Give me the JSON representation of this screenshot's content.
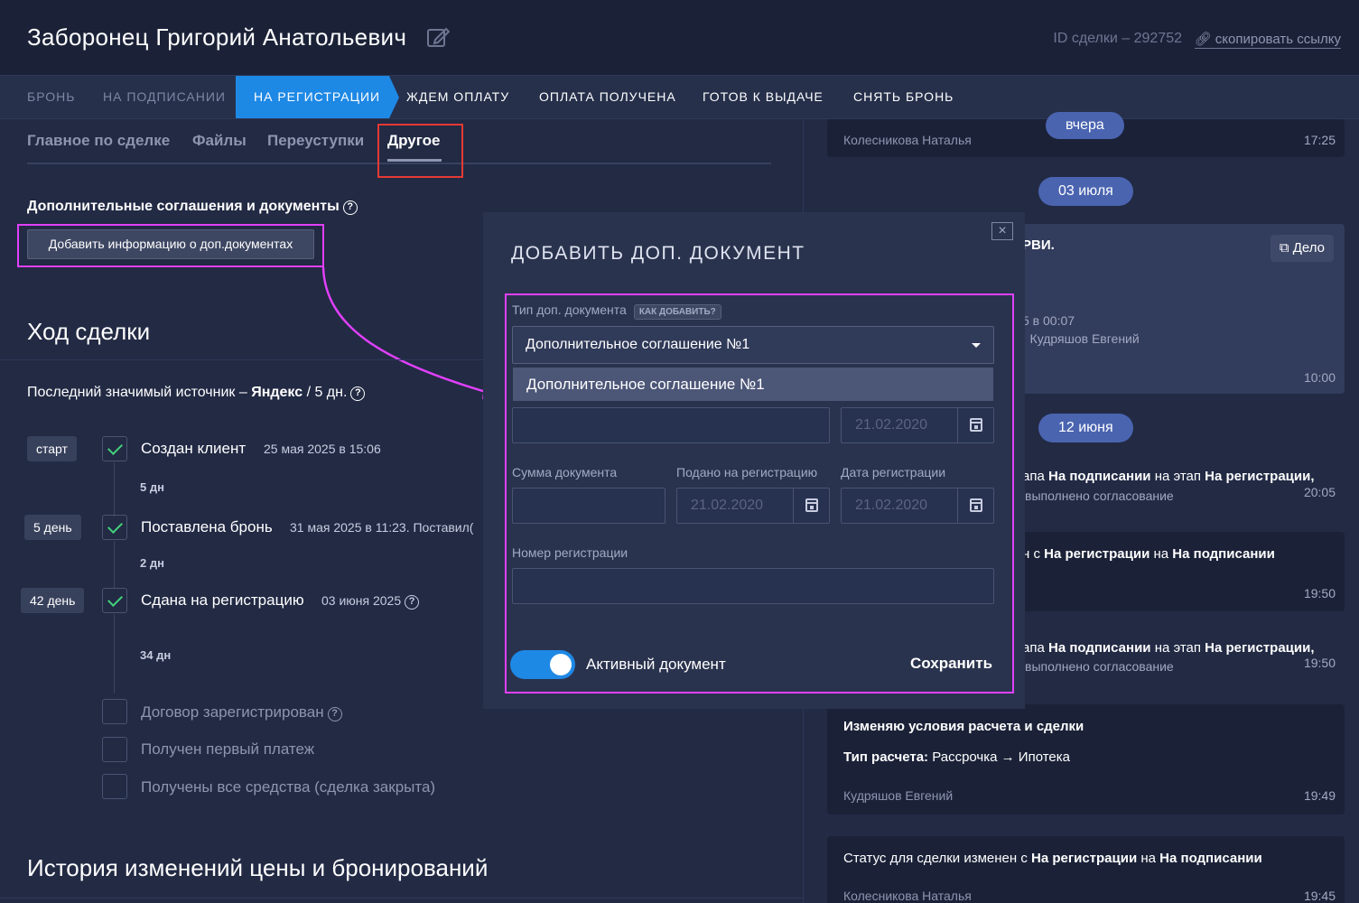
{
  "header": {
    "client_name": "Заборонец Григорий Анатольевич",
    "deal_id": "ID сделки – 292752",
    "copy_link": "скопировать ссылку"
  },
  "stages": [
    {
      "label": "Бронь",
      "state": "past"
    },
    {
      "label": "На подписании",
      "state": "past"
    },
    {
      "label": "На регистрации",
      "state": "active"
    },
    {
      "label": "Ждем оплату",
      "state": "future"
    },
    {
      "label": "Оплата получена",
      "state": "future"
    },
    {
      "label": "Готов к выдаче",
      "state": "future"
    },
    {
      "label": "Снять бронь",
      "state": "future"
    }
  ],
  "subtabs": [
    "Главное по сделке",
    "Файлы",
    "Переуступки",
    "Другое"
  ],
  "subtab_active": "Другое",
  "docs": {
    "title": "Дополнительные соглашения и документы",
    "add_button": "Добавить информацию о доп.документах"
  },
  "deal_progress": {
    "title": "Ход сделки",
    "source_prefix": "Последний значимый источник –",
    "source_name": "Яндекс",
    "source_suffix": "/ 5 дн.",
    "steps": [
      {
        "badge": "старт",
        "title": "Создан клиент",
        "date": "25 мая 2025 в 15:06",
        "gap_after": "5 дн"
      },
      {
        "badge": "5 день",
        "title": "Поставлена бронь",
        "date": "31 мая 2025 в 11:23. Поставил(",
        "gap_after": "2 дн"
      },
      {
        "badge": "42 день",
        "title": "Сдана на регистрацию",
        "date": "03 июня 2025",
        "gap_after": "34 дн"
      }
    ],
    "pending": [
      "Договор зарегистрирован",
      "Получен первый платеж",
      "Получены все средства (сделка закрыта)"
    ]
  },
  "history_title": "История изменений цены и бронирований",
  "feed": {
    "card0": {
      "author": "Колесникова Наталья",
      "time": "17:25"
    },
    "pill_yesterday": "вчера",
    "pill_july": "03 июля",
    "card1": {
      "text_frag": "РВИ.",
      "badge": "Дело",
      "sub1": "5 в 00:07",
      "sub2": "· Кудряшов Евгений",
      "time": "10:00"
    },
    "pill_june": "12 июня",
    "card2": {
      "text_a": "апа",
      "bold_a": "На подписании",
      "text_b": "на этап",
      "bold_b": "На регистрации,",
      "sub": "выполнено согласование",
      "time": "20:05"
    },
    "card3": {
      "text_a": "н с",
      "bold_a": "На регистрации",
      "text_b": "на",
      "bold_b": "На подписании",
      "time": "19:50"
    },
    "card4": {
      "text_a": "апа",
      "bold_a": "На подписании",
      "text_b": "на этап",
      "bold_b": "На регистрации,",
      "sub": "выполнено согласование",
      "time": "19:50"
    },
    "card5": {
      "title": "Изменяю условия расчета и сделки",
      "label": "Тип расчета:",
      "value": "Рассрочка → Ипотека",
      "author": "Кудряшов Евгений",
      "time": "19:49"
    },
    "card6": {
      "text_a": "Статус для сделки изменен с",
      "bold_a": "На регистрации",
      "text_b": "на",
      "bold_b": "На подписании",
      "author": "Колесникова Наталья",
      "time": "19:45"
    }
  },
  "modal": {
    "title": "ДОБАВИТЬ ДОП. ДОКУМЕНТ",
    "close": "×",
    "doc_type_label": "Тип доп. документа",
    "how_to_add": "КАК ДОБАВИТЬ?",
    "doc_type_value": "Дополнительное соглашение №1",
    "dropdown_option": "Дополнительное соглашение №1",
    "date_placeholder": "21.02.2020",
    "amount_label": "Сумма документа",
    "submitted_label": "Подано на регистрацию",
    "reg_date_label": "Дата регистрации",
    "reg_number_label": "Номер регистрации",
    "active_label": "Активный документ",
    "active": true,
    "save": "Сохранить"
  },
  "colors": {
    "accent": "#1e88e5",
    "highlight_box": "#e040fb",
    "tab_box": "#e53935",
    "check": "#43d17a"
  }
}
